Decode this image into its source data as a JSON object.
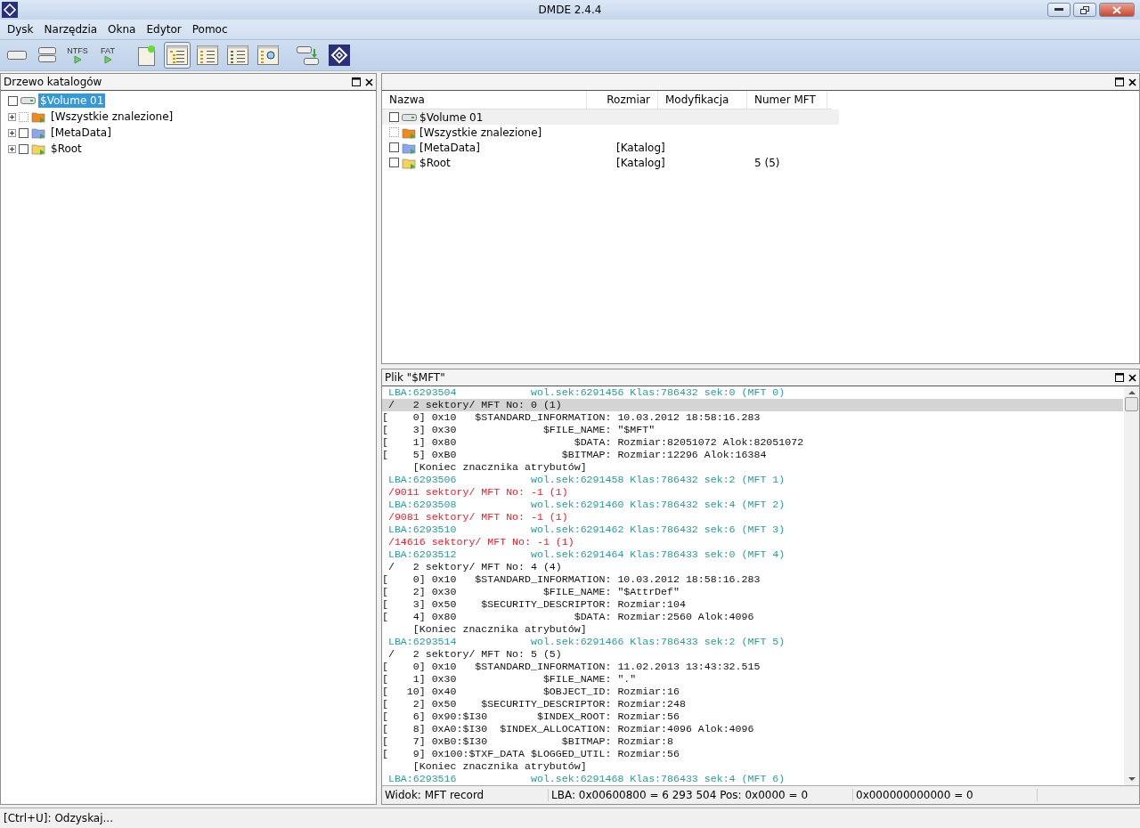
{
  "window": {
    "title": "DMDE 2.4.4"
  },
  "menu": [
    "Dysk",
    "Narzędzia",
    "Okna",
    "Edytor",
    "Pomoc"
  ],
  "toolbar": [
    {
      "kind": "drive",
      "selected": false
    },
    {
      "kind": "disks",
      "selected": false
    },
    {
      "kind": "scan",
      "label": "NTFS",
      "selected": false
    },
    {
      "kind": "scan",
      "label": "FAT",
      "selected": false
    },
    {
      "kind": "sheet",
      "selected": false
    },
    {
      "kind": "tree",
      "selected": true
    },
    {
      "kind": "list",
      "selected": false
    },
    {
      "kind": "grid",
      "selected": false
    },
    {
      "kind": "search",
      "selected": false
    },
    {
      "kind": "copy",
      "selected": false
    },
    {
      "kind": "logo",
      "selected": false
    }
  ],
  "tree_panel": {
    "title": "Drzewo katalogów",
    "items": [
      {
        "label": "$Volume 01",
        "kind": "drive",
        "selected": true,
        "disabled": false,
        "children": [
          {
            "label": "[Wszystkie znalezione]",
            "kind": "folder",
            "color": "#f08a1c",
            "expanded": false,
            "selected": false,
            "disabled": true
          },
          {
            "label": "[MetaData]",
            "kind": "folder",
            "color": "#8aa6ee",
            "expanded": false,
            "selected": false,
            "disabled": false
          },
          {
            "label": "$Root",
            "kind": "folder",
            "color": "#f4d35a",
            "expanded": false,
            "selected": false,
            "disabled": false
          }
        ]
      }
    ]
  },
  "file_panel": {
    "columns": [
      "Nazwa",
      "Rozmiar",
      "Modyfikacja",
      "Numer MFT"
    ],
    "rows": [
      {
        "name": "$Volume 01",
        "kind": "drive",
        "selected": true,
        "disabled": false
      },
      {
        "name": "[Wszystkie znalezione]",
        "kind": "folder",
        "color": "#f08a1c",
        "selected": false,
        "disabled": true
      },
      {
        "name": "[MetaData]",
        "kind": "folder",
        "color": "#8aa6ee",
        "size": "[Katalog]",
        "selected": false,
        "disabled": false
      },
      {
        "name": "$Root",
        "kind": "folder",
        "color": "#f4d35a",
        "size": "[Katalog]",
        "mft": "5 (5)",
        "selected": false,
        "disabled": false
      }
    ]
  },
  "record_panel": {
    "title": "Plik \"$MFT\"",
    "lines": [
      {
        "kind": "lba",
        "text": " LBA:6293504            wol.sek:6291456 Klas:786432 sek:0 (MFT 0)"
      },
      {
        "kind": "current",
        "text": " /   2 sektory/ MFT No: 0 (1)"
      },
      {
        "kind": "attr",
        "text": "[    0] 0x10   $STANDARD_INFORMATION: 10.03.2012 18:58:16.283"
      },
      {
        "kind": "attr",
        "text": "[    3] 0x30              $FILE_NAME: \"$MFT\""
      },
      {
        "kind": "attr",
        "text": "[    1] 0x80                   $DATA: Rozmiar:82051072 Alok:82051072"
      },
      {
        "kind": "attr",
        "text": "[    5] 0xB0                 $BITMAP: Rozmiar:12296 Alok:16384"
      },
      {
        "kind": "attr",
        "text": "     [Koniec znacznika atrybutów]"
      },
      {
        "kind": "lba",
        "text": " LBA:6293506            wol.sek:6291458 Klas:786432 sek:2 (MFT 1)"
      },
      {
        "kind": "error",
        "text": " /9011 sektory/ MFT No: -1 (1)"
      },
      {
        "kind": "lba",
        "text": " LBA:6293508            wol.sek:6291460 Klas:786432 sek:4 (MFT 2)"
      },
      {
        "kind": "error",
        "text": " /9081 sektory/ MFT No: -1 (1)"
      },
      {
        "kind": "lba",
        "text": " LBA:6293510            wol.sek:6291462 Klas:786432 sek:6 (MFT 3)"
      },
      {
        "kind": "error",
        "text": " /14616 sektory/ MFT No: -1 (1)"
      },
      {
        "kind": "lba",
        "text": " LBA:6293512            wol.sek:6291464 Klas:786433 sek:0 (MFT 4)"
      },
      {
        "kind": "attr",
        "text": " /   2 sektory/ MFT No: 4 (4)"
      },
      {
        "kind": "attr",
        "text": "[    0] 0x10   $STANDARD_INFORMATION: 10.03.2012 18:58:16.283"
      },
      {
        "kind": "attr",
        "text": "[    2] 0x30              $FILE_NAME: \"$AttrDef\""
      },
      {
        "kind": "attr",
        "text": "[    3] 0x50    $SECURITY_DESCRIPTOR: Rozmiar:104"
      },
      {
        "kind": "attr",
        "text": "[    4] 0x80                   $DATA: Rozmiar:2560 Alok:4096"
      },
      {
        "kind": "attr",
        "text": "     [Koniec znacznika atrybutów]"
      },
      {
        "kind": "lba",
        "text": " LBA:6293514            wol.sek:6291466 Klas:786433 sek:2 (MFT 5)"
      },
      {
        "kind": "attr",
        "text": " /   2 sektory/ MFT No: 5 (5)"
      },
      {
        "kind": "attr",
        "text": "[    0] 0x10   $STANDARD_INFORMATION: 11.02.2013 13:43:32.515"
      },
      {
        "kind": "attr",
        "text": "[    1] 0x30              $FILE_NAME: \".\""
      },
      {
        "kind": "attr",
        "text": "[   10] 0x40              $OBJECT_ID: Rozmiar:16"
      },
      {
        "kind": "attr",
        "text": "[    2] 0x50    $SECURITY_DESCRIPTOR: Rozmiar:248"
      },
      {
        "kind": "attr",
        "text": "[    6] 0x90:$I30        $INDEX_ROOT: Rozmiar:56"
      },
      {
        "kind": "attr",
        "text": "[    8] 0xA0:$I30  $INDEX_ALLOCATION: Rozmiar:4096 Alok:4096"
      },
      {
        "kind": "attr",
        "text": "[    7] 0xB0:$I30            $BITMAP: Rozmiar:8"
      },
      {
        "kind": "attr",
        "text": "[    9] 0x100:$TXF_DATA $LOGGED_UTIL: Rozmiar:56"
      },
      {
        "kind": "attr",
        "text": "     [Koniec znacznika atrybutów]"
      },
      {
        "kind": "lba",
        "text": " LBA:6293516            wol.sek:6291468 Klas:786433 sek:4 (MFT 6)"
      }
    ],
    "status": [
      "Widok: MFT record",
      "LBA: 0x00600800 = 6 293 504  Pos: 0x0000 = 0",
      "0x000000000000 = 0"
    ]
  },
  "status_bar": "[Ctrl+U]: Odzyskaj..."
}
